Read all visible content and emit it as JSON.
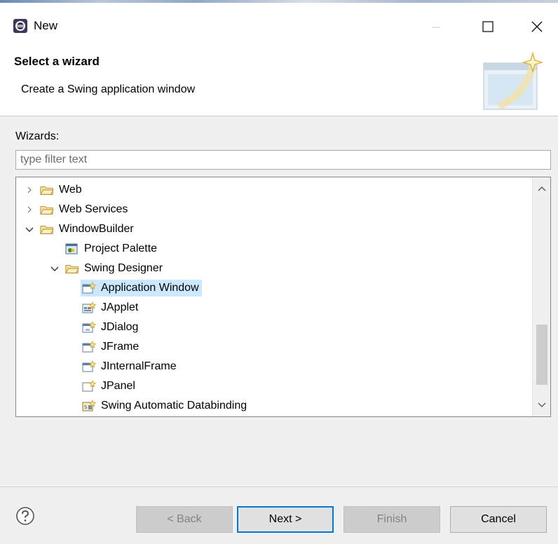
{
  "window": {
    "title": "New"
  },
  "header": {
    "title": "Select a wizard",
    "description": "Create a Swing application window"
  },
  "wizards": {
    "label": "Wizards:",
    "filter_placeholder": "type filter text"
  },
  "tree": {
    "items": [
      {
        "label": "Web",
        "level": 0,
        "expanded": false,
        "icon": "folder-icon"
      },
      {
        "label": "Web Services",
        "level": 0,
        "expanded": false,
        "icon": "folder-icon"
      },
      {
        "label": "WindowBuilder",
        "level": 0,
        "expanded": true,
        "icon": "folder-open-icon"
      },
      {
        "label": "Project Palette",
        "level": 1,
        "icon": "palette-icon"
      },
      {
        "label": "Swing Designer",
        "level": 1,
        "expanded": true,
        "icon": "folder-open-icon"
      },
      {
        "label": "Application Window",
        "level": 2,
        "icon": "window-wizard-icon",
        "selected": true
      },
      {
        "label": "JApplet",
        "level": 2,
        "icon": "applet-wizard-icon"
      },
      {
        "label": "JDialog",
        "level": 2,
        "icon": "dialog-wizard-icon"
      },
      {
        "label": "JFrame",
        "level": 2,
        "icon": "window-wizard-icon"
      },
      {
        "label": "JInternalFrame",
        "level": 2,
        "icon": "window-wizard-icon"
      },
      {
        "label": "JPanel",
        "level": 2,
        "icon": "panel-wizard-icon"
      },
      {
        "label": "Swing Automatic Databinding",
        "level": 2,
        "icon": "databinding-icon"
      }
    ]
  },
  "buttons": {
    "back": "< Back",
    "next": "Next >",
    "finish": "Finish",
    "cancel": "Cancel"
  },
  "colors": {
    "selection": "#cce8ff",
    "default_button_border": "#0078d7"
  }
}
